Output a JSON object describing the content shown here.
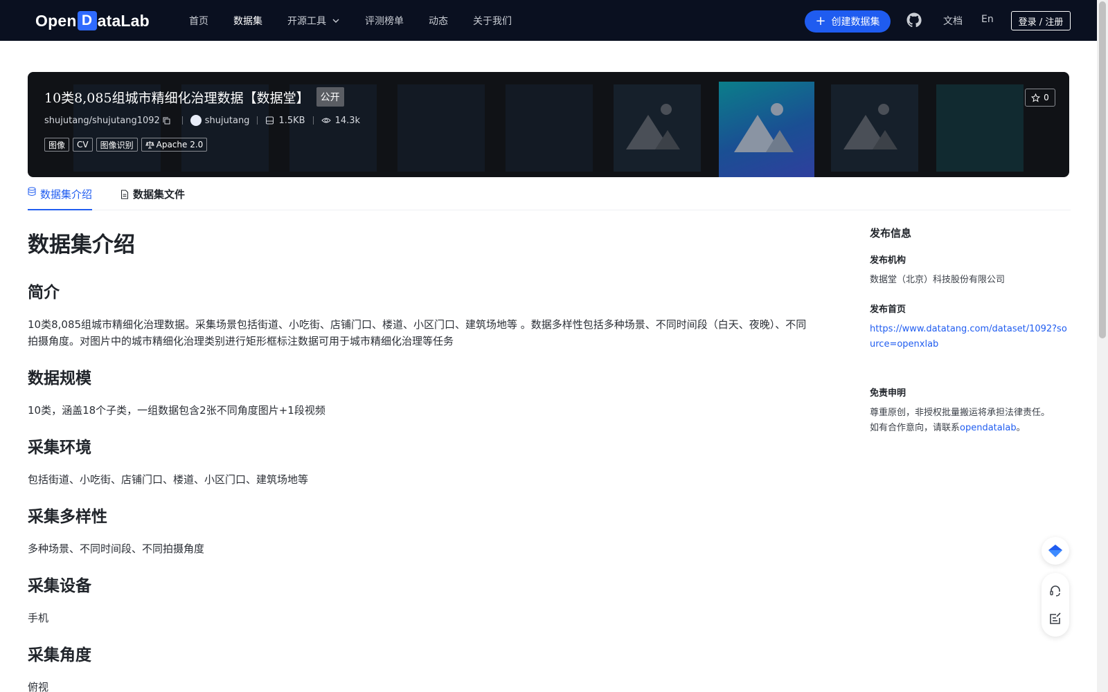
{
  "nav": {
    "logo_text_left": "Open",
    "logo_letter": "D",
    "logo_text_right": "ataLab",
    "links": [
      "首页",
      "数据集",
      "开源工具",
      "评测榜单",
      "动态",
      "关于我们"
    ],
    "create_button": "创建数据集",
    "docs": "文档",
    "language": "En",
    "login": "登录 / 注册"
  },
  "dataset": {
    "title": "10类8,085组城市精细化治理数据【数据堂】",
    "visibility": "公开",
    "repo": "shujutang/shujutang1092",
    "owner": "shujutang",
    "size": "1.5KB",
    "views": "14.3k",
    "tags": [
      "图像",
      "CV",
      "图像识别"
    ],
    "license": "Apache 2.0",
    "stars": "0"
  },
  "tabs": {
    "intro": "数据集介绍",
    "files": "数据集文件"
  },
  "content": {
    "heading": "数据集介绍",
    "sections": [
      {
        "title": "简介",
        "text": "10类8,085组城市精细化治理数据。采集场景包括街道、小吃街、店铺门口、楼道、小区门口、建筑场地等 。数据多样性包括多种场景、不同时间段（白天、夜晚）、不同拍摄角度。对图片中的城市精细化治理类别进行矩形框标注数据可用于城市精细化治理等任务"
      },
      {
        "title": "数据规模",
        "text": "10类，涵盖18个子类，一组数据包含2张不同角度图片+1段视频"
      },
      {
        "title": "采集环境",
        "text": "包括街道、小吃街、店铺门口、楼道、小区门口、建筑场地等"
      },
      {
        "title": "采集多样性",
        "text": "多种场景、不同时间段、不同拍摄角度"
      },
      {
        "title": "采集设备",
        "text": "手机"
      },
      {
        "title": "采集角度",
        "text": "俯视"
      }
    ]
  },
  "sidebar": {
    "title": "发布信息",
    "org_label": "发布机构",
    "org_value": "数据堂（北京）科技股份有限公司",
    "home_label": "发布首页",
    "home_url": "https://www.datatang.com/dataset/1092?source=openxlab",
    "disclaimer_label": "免责申明",
    "disclaimer_line1": "尊重原创，非授权批量搬运将承担法律责任。",
    "disclaimer_line2_prefix": "如有合作意向，请联系",
    "disclaimer_link": "opendatalab",
    "disclaimer_line2_suffix": "。"
  },
  "icons": {
    "chevron": "chevron-down-icon",
    "github": "github-icon",
    "copy": "copy-icon",
    "disk": "disk-icon",
    "eye": "eye-icon",
    "scale": "scale-icon",
    "star": "star-icon",
    "database": "database-icon",
    "file": "file-icon",
    "headset": "headset-icon",
    "feedback": "feedback-icon"
  },
  "colors": {
    "nav_bg": "#0a1020",
    "accent": "#1f5cf0",
    "banner_bg": "#101216"
  }
}
